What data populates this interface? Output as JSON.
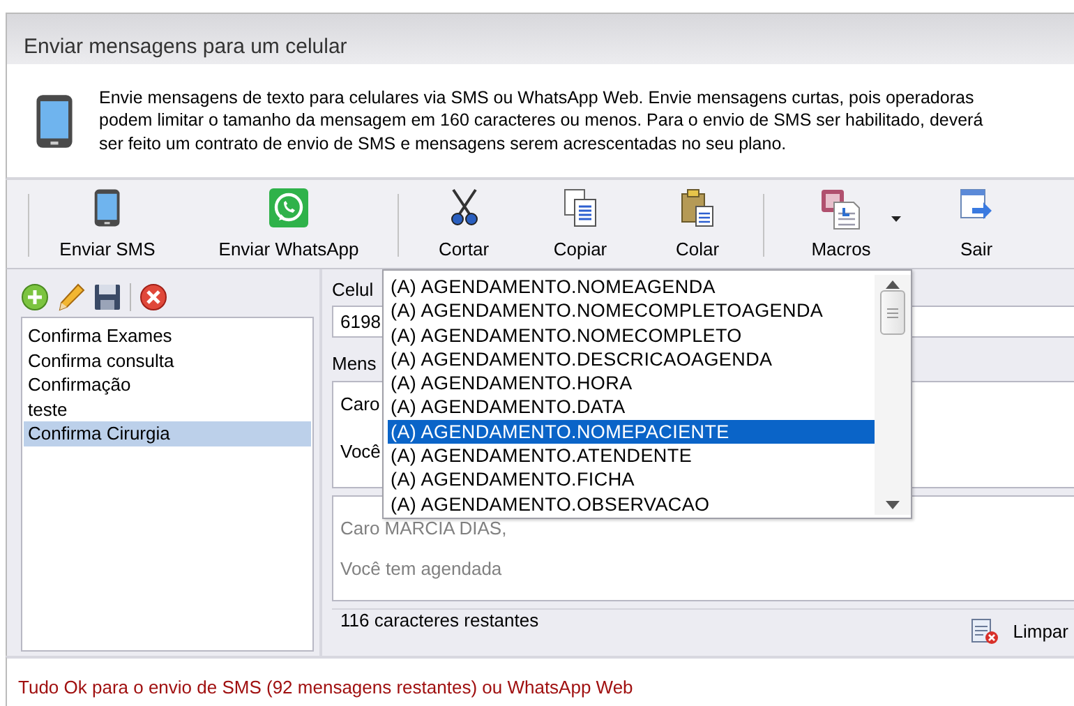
{
  "window": {
    "title": "Enviar mensagens para um celular"
  },
  "info": {
    "text": "Envie mensagens de texto para celulares via SMS ou WhatsApp Web. Envie mensagens curtas, pois operadoras podem limitar o tamanho da mensagem em 160 caracteres ou menos. Para o envio de SMS ser habilitado, deverá ser feito um contrato de envio de SMS e mensagens serem acrescentadas no seu plano."
  },
  "toolbar": [
    {
      "label": "Enviar SMS",
      "kind": "sms",
      "has_menu": false
    },
    {
      "label": "Enviar WhatsApp",
      "kind": "whatsapp",
      "has_menu": false
    },
    {
      "kind": "separator"
    },
    {
      "label": "Cortar",
      "kind": "cut",
      "has_menu": false
    },
    {
      "label": "Copiar",
      "kind": "copy",
      "has_menu": false
    },
    {
      "label": "Colar",
      "kind": "paste",
      "has_menu": false
    },
    {
      "kind": "separator"
    },
    {
      "label": "Macros",
      "kind": "macros",
      "has_menu": true
    },
    {
      "label": "Sair",
      "kind": "exit",
      "has_menu": false
    }
  ],
  "templates": {
    "items": [
      {
        "label": "Confirma Exames",
        "selected": false
      },
      {
        "label": "Confirma consulta",
        "selected": false
      },
      {
        "label": "Confirmação",
        "selected": false
      },
      {
        "label": "teste",
        "selected": false
      },
      {
        "label": "Confirma Cirurgia",
        "selected": true
      }
    ]
  },
  "form": {
    "phone_label": "Celul",
    "phone_value": "6198",
    "message_label": "Mens",
    "message_lines": [
      "Caro",
      "Você"
    ],
    "preview_lines": [
      "Caro MARCIA DIAS,",
      "Você tem agendada"
    ],
    "remaining": "116 caracteres restantes",
    "clear_button": "Limpar"
  },
  "macro_menu": {
    "items": [
      {
        "label": "(A) AGENDAMENTO.NOMEAGENDA",
        "selected": false
      },
      {
        "label": "(A) AGENDAMENTO.NOMECOMPLETOAGENDA",
        "selected": false
      },
      {
        "label": "(A) AGENDAMENTO.NOMECOMPLETO",
        "selected": false
      },
      {
        "label": "(A) AGENDAMENTO.DESCRICAOAGENDA",
        "selected": false
      },
      {
        "label": "(A) AGENDAMENTO.HORA",
        "selected": false
      },
      {
        "label": "(A) AGENDAMENTO.DATA",
        "selected": false
      },
      {
        "label": "(A) AGENDAMENTO.NOMEPACIENTE",
        "selected": true
      },
      {
        "label": "(A) AGENDAMENTO.ATENDENTE",
        "selected": false
      },
      {
        "label": "(A) AGENDAMENTO.FICHA",
        "selected": false
      },
      {
        "label": "(A) AGENDAMENTO.OBSERVACAO",
        "selected": false
      }
    ]
  },
  "status": {
    "text": "Tudo Ok para o envio de SMS (92 mensagens restantes) ou WhatsApp Web"
  }
}
